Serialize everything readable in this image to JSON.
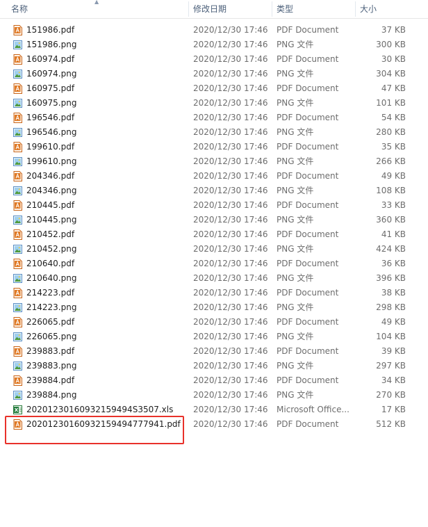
{
  "header": {
    "name": "名称",
    "date": "修改日期",
    "type": "类型",
    "size": "大小"
  },
  "colors": {
    "pdf_icon": "#d9731f",
    "png_icon": "#3b7bbf",
    "xls_icon": "#1f7a3a",
    "highlight": "#e8312a",
    "header_text": "#4c607a"
  },
  "files": [
    {
      "name": "151986.pdf",
      "date": "2020/12/30 17:46",
      "type": "PDF Document",
      "size": "37 KB",
      "icon": "pdf-icon"
    },
    {
      "name": "151986.png",
      "date": "2020/12/30 17:46",
      "type": "PNG 文件",
      "size": "300 KB",
      "icon": "png-icon"
    },
    {
      "name": "160974.pdf",
      "date": "2020/12/30 17:46",
      "type": "PDF Document",
      "size": "30 KB",
      "icon": "pdf-icon"
    },
    {
      "name": "160974.png",
      "date": "2020/12/30 17:46",
      "type": "PNG 文件",
      "size": "304 KB",
      "icon": "png-icon"
    },
    {
      "name": "160975.pdf",
      "date": "2020/12/30 17:46",
      "type": "PDF Document",
      "size": "47 KB",
      "icon": "pdf-icon"
    },
    {
      "name": "160975.png",
      "date": "2020/12/30 17:46",
      "type": "PNG 文件",
      "size": "101 KB",
      "icon": "png-icon"
    },
    {
      "name": "196546.pdf",
      "date": "2020/12/30 17:46",
      "type": "PDF Document",
      "size": "54 KB",
      "icon": "pdf-icon"
    },
    {
      "name": "196546.png",
      "date": "2020/12/30 17:46",
      "type": "PNG 文件",
      "size": "280 KB",
      "icon": "png-icon"
    },
    {
      "name": "199610.pdf",
      "date": "2020/12/30 17:46",
      "type": "PDF Document",
      "size": "35 KB",
      "icon": "pdf-icon"
    },
    {
      "name": "199610.png",
      "date": "2020/12/30 17:46",
      "type": "PNG 文件",
      "size": "266 KB",
      "icon": "png-icon"
    },
    {
      "name": "204346.pdf",
      "date": "2020/12/30 17:46",
      "type": "PDF Document",
      "size": "49 KB",
      "icon": "pdf-icon"
    },
    {
      "name": "204346.png",
      "date": "2020/12/30 17:46",
      "type": "PNG 文件",
      "size": "108 KB",
      "icon": "png-icon"
    },
    {
      "name": "210445.pdf",
      "date": "2020/12/30 17:46",
      "type": "PDF Document",
      "size": "33 KB",
      "icon": "pdf-icon"
    },
    {
      "name": "210445.png",
      "date": "2020/12/30 17:46",
      "type": "PNG 文件",
      "size": "360 KB",
      "icon": "png-icon"
    },
    {
      "name": "210452.pdf",
      "date": "2020/12/30 17:46",
      "type": "PDF Document",
      "size": "41 KB",
      "icon": "pdf-icon"
    },
    {
      "name": "210452.png",
      "date": "2020/12/30 17:46",
      "type": "PNG 文件",
      "size": "424 KB",
      "icon": "png-icon"
    },
    {
      "name": "210640.pdf",
      "date": "2020/12/30 17:46",
      "type": "PDF Document",
      "size": "36 KB",
      "icon": "pdf-icon"
    },
    {
      "name": "210640.png",
      "date": "2020/12/30 17:46",
      "type": "PNG 文件",
      "size": "396 KB",
      "icon": "png-icon"
    },
    {
      "name": "214223.pdf",
      "date": "2020/12/30 17:46",
      "type": "PDF Document",
      "size": "38 KB",
      "icon": "pdf-icon"
    },
    {
      "name": "214223.png",
      "date": "2020/12/30 17:46",
      "type": "PNG 文件",
      "size": "298 KB",
      "icon": "png-icon"
    },
    {
      "name": "226065.pdf",
      "date": "2020/12/30 17:46",
      "type": "PDF Document",
      "size": "49 KB",
      "icon": "pdf-icon"
    },
    {
      "name": "226065.png",
      "date": "2020/12/30 17:46",
      "type": "PNG 文件",
      "size": "104 KB",
      "icon": "png-icon"
    },
    {
      "name": "239883.pdf",
      "date": "2020/12/30 17:46",
      "type": "PDF Document",
      "size": "39 KB",
      "icon": "pdf-icon"
    },
    {
      "name": "239883.png",
      "date": "2020/12/30 17:46",
      "type": "PNG 文件",
      "size": "297 KB",
      "icon": "png-icon"
    },
    {
      "name": "239884.pdf",
      "date": "2020/12/30 17:46",
      "type": "PDF Document",
      "size": "34 KB",
      "icon": "pdf-icon"
    },
    {
      "name": "239884.png",
      "date": "2020/12/30 17:46",
      "type": "PNG 文件",
      "size": "270 KB",
      "icon": "png-icon"
    },
    {
      "name": "20201230160932159494S3507.xls",
      "date": "2020/12/30 17:46",
      "type": "Microsoft Office...",
      "size": "17 KB",
      "icon": "xls-icon"
    },
    {
      "name": "20201230160932159494777941.pdf",
      "date": "2020/12/30 17:46",
      "type": "PDF Document",
      "size": "512 KB",
      "icon": "pdf-icon"
    }
  ]
}
